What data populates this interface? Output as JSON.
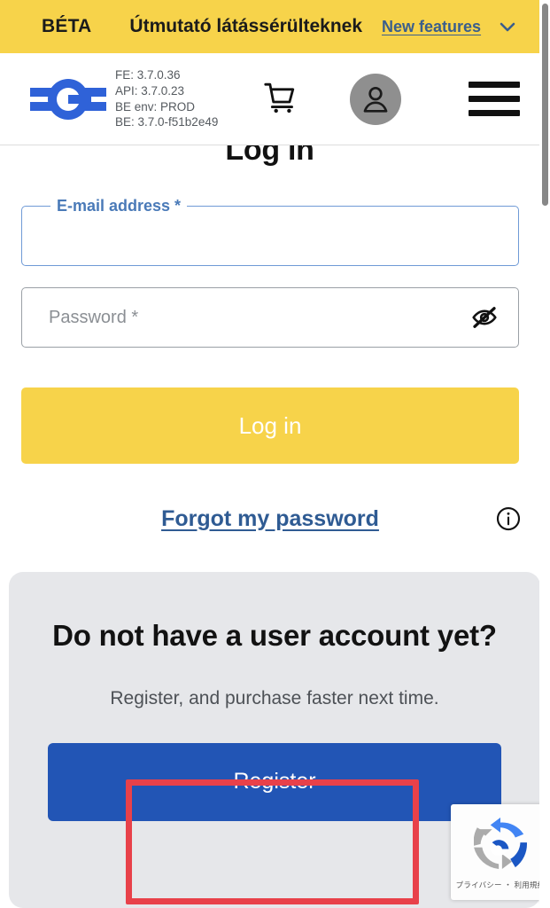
{
  "beta_banner": {
    "tag": "BÉTA",
    "guide_label": "Útmutató látássérülteknek",
    "new_features_label": "New features",
    "chevron_icon": "chevron-down-icon",
    "background_color": "#F7D34A",
    "link_color": "#3A5E8C"
  },
  "header": {
    "logo_icon": "brand-logo-icon",
    "versions": {
      "fe": "FE: 3.7.0.36",
      "api": "API: 3.7.0.23",
      "be_env": "BE env: PROD",
      "be": "BE: 3.7.0-f51b2e49"
    },
    "cart_icon": "shopping-cart-icon",
    "avatar_icon": "user-avatar-icon",
    "menu_icon": "hamburger-menu-icon",
    "avatar_background": "#8F8F8F"
  },
  "main": {
    "title": "Log in",
    "email": {
      "label": "E-mail address *",
      "value": "",
      "placeholder": "",
      "focused": true,
      "label_color": "#4A7AB8"
    },
    "password": {
      "label": "Password *",
      "value": "",
      "placeholder": "Password *",
      "toggle_icon": "eye-off-icon"
    },
    "login_button": "Log in",
    "login_button_color": "#F7D34A",
    "forgot_password_link": "Forgot my password",
    "info_icon": "info-circle-icon"
  },
  "register_panel": {
    "heading": "Do not have a user account yet?",
    "subtext": "Register, and purchase faster next time.",
    "button_label": "Register",
    "button_color": "#2255B5",
    "background_color": "#E6E7EA"
  },
  "annotation": {
    "name": "register-button-highlight",
    "color": "#E8414A"
  },
  "recaptcha": {
    "icon": "recaptcha-icon",
    "text": "プライバシー ・ 利用規約"
  },
  "scrollbar": {
    "orientation": "vertical",
    "thumb_color": "#878787"
  }
}
